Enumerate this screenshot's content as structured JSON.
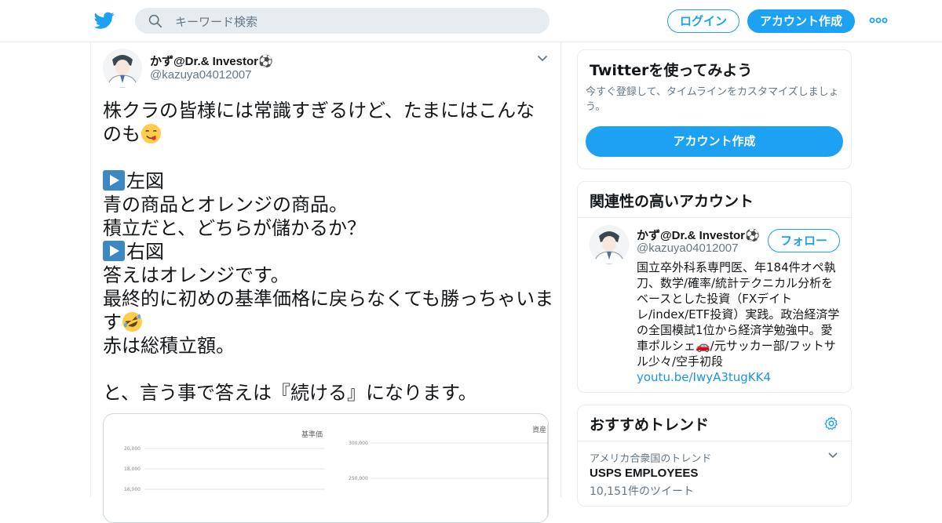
{
  "header": {
    "search_placeholder": "キーワード検索",
    "login_label": "ログイン",
    "signup_label": "アカウント作成",
    "brand_color": "#1da1f2"
  },
  "tweet": {
    "author_name": "かず@Dr.& Investor⚽️",
    "author_handle": "@kazuya04012007",
    "lines": [
      "株クラの皆様には常識すぎるけど、たまにはこんな",
      "のも",
      "",
      "左図",
      "青の商品とオレンジの商品。",
      "積立だと、どちらが儲かるか？",
      "右図",
      "答えはオレンジです。",
      "最終的に初めの基準価格に戻らなくても勝っちゃいま",
      "す",
      "赤は総積立額。",
      "",
      "と、言う事で答えは『続ける』になります。"
    ],
    "media": {
      "left_chart_title": "基準価",
      "left_ticks": [
        "20,000",
        "18,000",
        "16,000"
      ],
      "right_chart_title": "資産",
      "right_ticks": [
        "300,000",
        "250,000"
      ]
    }
  },
  "sidebar": {
    "try_card": {
      "title": "Twitterを使ってみよう",
      "description": "今すぐ登録して、タイムラインをカスタマイズしましょう。",
      "cta_label": "アカウント作成"
    },
    "related_card": {
      "title": "関連性の高いアカウント",
      "account_name": "かず@Dr.& Investor⚽️",
      "account_handle": "@kazuya04012007",
      "follow_label": "フォロー",
      "bio": "国立卒外科系専門医、年184件オペ執刀、数学/確率/統計テクニカル分析をベースとした投資（FXデイトレ/index/ETF投資）実践。政治経済学の全国模試1位から経済学勉強中。愛車ポルシェ🚗/元サッカー部/フットサル少々/空手初段",
      "bio_link": "youtu.be/IwyA3tugKK4"
    },
    "trends_card": {
      "title": "おすすめトレンド",
      "trend_location": "アメリカ合衆国のトレンド",
      "trend_name": "USPS EMPLOYEES",
      "trend_count": "10,151件のツイート"
    }
  }
}
